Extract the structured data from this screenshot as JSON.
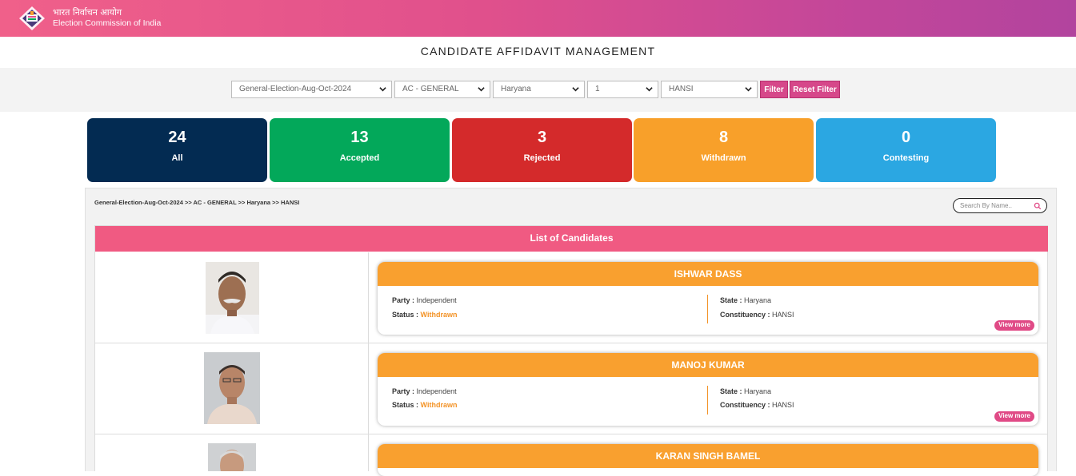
{
  "header": {
    "org_hindi": "भारत निर्वाचन आयोग",
    "org_english": "Election Commission of India",
    "logo_icon": "ballot-box-logo-icon"
  },
  "page_title": "CANDIDATE AFFIDAVIT MANAGEMENT",
  "filters": {
    "election": "General-Election-Aug-Oct-2024",
    "constituency_type": "AC - GENERAL",
    "state": "Haryana",
    "phase": "1",
    "constituency": "HANSI",
    "filter_label": "Filter",
    "reset_label": "Reset Filter"
  },
  "summary_cards": [
    {
      "count": "24",
      "label": "All",
      "color": "#032b52"
    },
    {
      "count": "13",
      "label": "Accepted",
      "color": "#03a85a"
    },
    {
      "count": "3",
      "label": "Rejected",
      "color": "#d42a2b"
    },
    {
      "count": "8",
      "label": "Withdrawn",
      "color": "#f8a02a"
    },
    {
      "count": "0",
      "label": "Contesting",
      "color": "#2ba7e2"
    }
  ],
  "breadcrumb": "General-Election-Aug-Oct-2024 >> AC - GENERAL >> Haryana >> HANSI",
  "search": {
    "placeholder": "Search By Name.."
  },
  "table": {
    "heading": "List of Candidates",
    "candidates": [
      {
        "name": "ISHWAR DASS",
        "party_label": "Party :",
        "party": "Independent",
        "status_label": "Status :",
        "status": "Withdrawn",
        "state_label": "State :",
        "state": "Haryana",
        "constituency_label": "Constituency :",
        "constituency": "HANSI",
        "view_more": "View more"
      },
      {
        "name": "MANOJ KUMAR",
        "party_label": "Party :",
        "party": "Independent",
        "status_label": "Status :",
        "status": "Withdrawn",
        "state_label": "State :",
        "state": "Haryana",
        "constituency_label": "Constituency :",
        "constituency": "HANSI",
        "view_more": "View more"
      },
      {
        "name": "KARAN SINGH BAMEL"
      }
    ]
  },
  "colors": {
    "header_gradient_start": "#f0608a",
    "header_gradient_end": "#b2449e",
    "accent_pink": "#f05a82",
    "accent_orange": "#f9a02f"
  }
}
